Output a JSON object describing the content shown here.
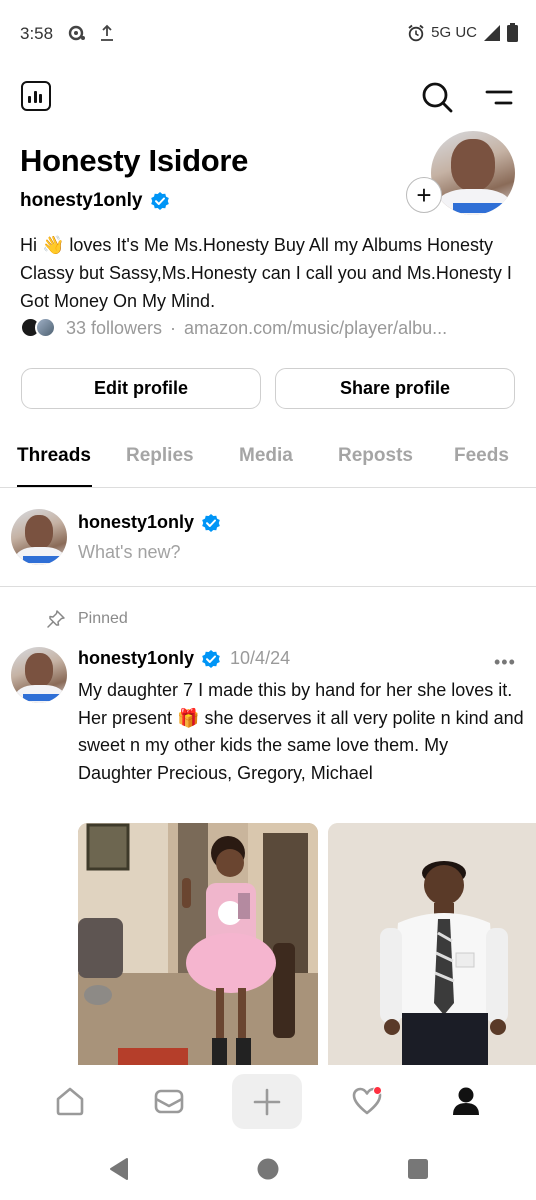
{
  "status_bar": {
    "time": "3:58",
    "network": "5G UC",
    "icons": [
      "notification-icon",
      "upload-icon",
      "alarm-icon",
      "signal-icon",
      "battery-icon"
    ]
  },
  "top_nav": {
    "icons": [
      "insights-icon",
      "search-icon",
      "menu-icon"
    ]
  },
  "profile": {
    "name": "Honesty Isidore",
    "handle": "honesty1only",
    "verified": true,
    "bio": "Hi 👋 loves It's Me Ms.Honesty Buy All my Albums Honesty Classy but Sassy,Ms.Honesty can I call you and Ms.Honesty I Got Money On My Mind.",
    "followers": "33 followers",
    "separator": "·",
    "link": "amazon.com/music/player/albu..."
  },
  "buttons": {
    "edit_profile": "Edit profile",
    "share_profile": "Share profile"
  },
  "tabs": [
    {
      "label": "Threads",
      "active": true
    },
    {
      "label": "Replies",
      "active": false
    },
    {
      "label": "Media",
      "active": false
    },
    {
      "label": "Reposts",
      "active": false
    },
    {
      "label": "Feeds",
      "active": false
    }
  ],
  "composer": {
    "handle": "honesty1only",
    "prompt": "What's new?"
  },
  "post": {
    "pinned_label": "Pinned",
    "handle": "honesty1only",
    "date": "10/4/24",
    "more": "•••",
    "text": "My daughter 7 I made this by hand for her she loves it. Her present 🎁 she deserves it all very polite n kind and sweet n my other kids the same love them. My Daughter Precious, Gregory, Michael"
  },
  "bottom_nav": {
    "icons": [
      "home-icon",
      "mail-icon",
      "plus-icon",
      "heart-icon",
      "profile-icon"
    ]
  },
  "colors": {
    "verified_blue": "#0095f6",
    "notification_red": "#ff3040",
    "inactive_tab": "#a5a5a5"
  }
}
